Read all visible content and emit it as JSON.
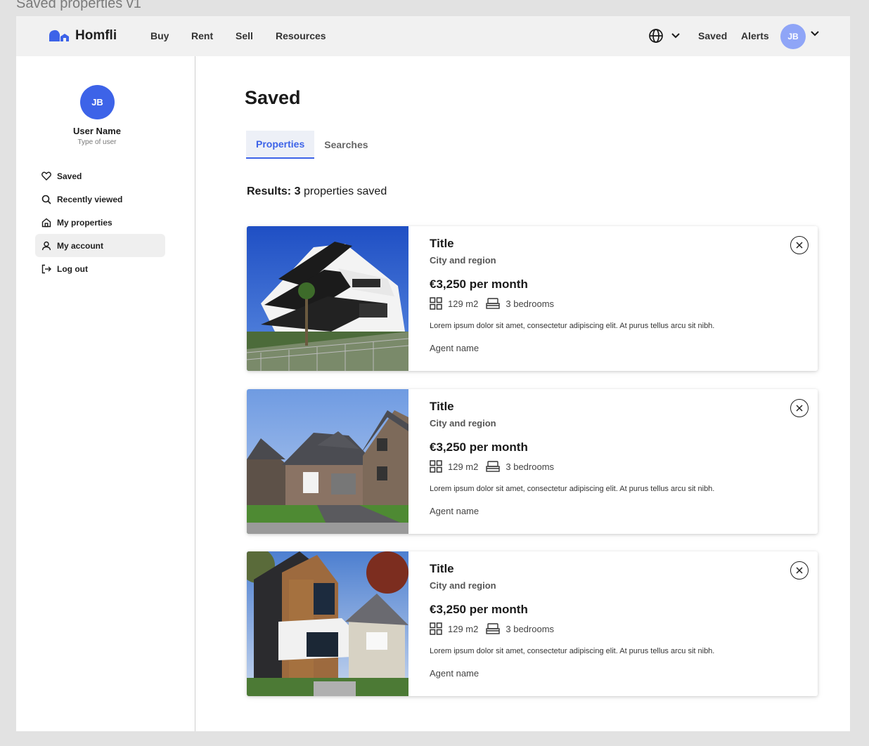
{
  "frame_label": "Saved properties v1",
  "nav": {
    "brand": "Homfli",
    "links": [
      "Buy",
      "Rent",
      "Sell",
      "Resources"
    ],
    "saved": "Saved",
    "alerts": "Alerts",
    "avatar_initials": "JB",
    "brand_color": "#3d63e8"
  },
  "sidebar": {
    "avatar_initials": "JB",
    "user_name": "User Name",
    "user_type": "Type of user",
    "items": [
      {
        "label": "Saved",
        "icon": "heart-icon"
      },
      {
        "label": "Recently viewed",
        "icon": "search-icon"
      },
      {
        "label": "My properties",
        "icon": "home-icon"
      },
      {
        "label": "My account",
        "icon": "user-icon",
        "active": true
      },
      {
        "label": "Log out",
        "icon": "logout-icon"
      }
    ]
  },
  "main": {
    "title": "Saved",
    "tabs": [
      {
        "label": "Properties",
        "active": true
      },
      {
        "label": "Searches",
        "active": false
      }
    ],
    "results": {
      "prefix": "Results:",
      "count": "3",
      "suffix": "properties saved"
    },
    "cards": [
      {
        "title": "Title",
        "region": "City and region",
        "price": "€3,250 per month",
        "area": "129 m2",
        "bedrooms": "3 bedrooms",
        "description": "Lorem ipsum dolor sit amet, consectetur adipiscing elit. At purus tellus arcu sit nibh.",
        "agent": "Agent name"
      },
      {
        "title": "Title",
        "region": "City and region",
        "price": "€3,250 per month",
        "area": "129 m2",
        "bedrooms": "3 bedrooms",
        "description": "Lorem ipsum dolor sit amet, consectetur adipiscing elit. At purus tellus arcu sit nibh.",
        "agent": "Agent name"
      },
      {
        "title": "Title",
        "region": "City and region",
        "price": "€3,250 per month",
        "area": "129 m2",
        "bedrooms": "3 bedrooms",
        "description": "Lorem ipsum dolor sit amet, consectetur adipiscing elit. At purus tellus arcu sit nibh.",
        "agent": "Agent name"
      }
    ]
  }
}
